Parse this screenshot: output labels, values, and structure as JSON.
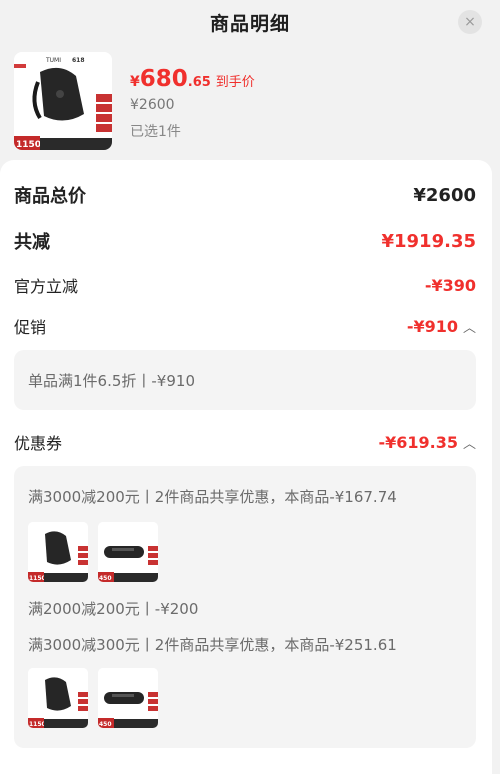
{
  "header": {
    "title": "商品明细",
    "close_icon": "×"
  },
  "product": {
    "price_currency": "¥",
    "price_integer": "680",
    "price_decimal": ".65",
    "price_tag": "到手价",
    "original_price": "¥2600",
    "selected_count": "已选1件",
    "thumb_brand": "TUMI",
    "thumb_event": "618",
    "thumb_price": "1150"
  },
  "summary": {
    "total_label": "商品总价",
    "total_value": "¥2600",
    "reduce_label": "共减",
    "reduce_value": "¥1919.35",
    "official_label": "官方立减",
    "official_value": "-¥390",
    "promo_label": "促销",
    "promo_value": "-¥910",
    "promo_detail": "单品满1件6.5折丨-¥910",
    "coupon_label": "优惠券",
    "coupon_value": "-¥619.35",
    "coupon_detail_1": "满3000减200元丨2件商品共享优惠，本商品-¥167.74",
    "coupon_detail_2": "满2000减200元丨-¥200",
    "coupon_detail_3": "满3000减300元丨2件商品共享优惠，本商品-¥251.61",
    "bag_price": "1150",
    "case_price": "450"
  },
  "colors": {
    "accent": "#f0302d",
    "panel_bg": "#ffffff",
    "page_bg": "#f2f2f2"
  }
}
